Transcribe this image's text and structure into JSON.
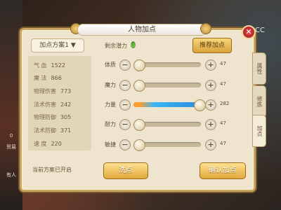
{
  "window": {
    "title": "人物加点",
    "title_decoration": "• • •   • • •",
    "close_label": "✕",
    "cc_label": "CC"
  },
  "left_strip": {
    "tag1": "0",
    "tag2": "贸易",
    "tag3": "有人"
  },
  "plan": {
    "selected": "加点方案1 ▼"
  },
  "stats": [
    {
      "label": "气  血",
      "value": "1522"
    },
    {
      "label": "魔  法",
      "value": "866"
    },
    {
      "label": "物理伤害",
      "value": "773"
    },
    {
      "label": "法术伤害",
      "value": "242"
    },
    {
      "label": "物理防御",
      "value": "305"
    },
    {
      "label": "法术防御",
      "value": "371"
    },
    {
      "label": "速  度",
      "value": "220"
    }
  ],
  "status_text": "当前方案已开启",
  "free_points": {
    "label": "剩余潜力",
    "value": "0"
  },
  "recommend_label": "推荐加点",
  "attributes": [
    {
      "name": "体质",
      "value": "47",
      "level": 0.03
    },
    {
      "name": "魔力",
      "value": "47",
      "level": 0.03
    },
    {
      "name": "力量",
      "value": "282",
      "level": 0.97
    },
    {
      "name": "耐力",
      "value": "47",
      "level": 0.03
    },
    {
      "name": "敏捷",
      "value": "47",
      "level": 0.03
    }
  ],
  "buttons": {
    "clear": "洗点",
    "confirm": "确认加点"
  },
  "side_tabs": [
    "属性",
    "修炼",
    "加点"
  ],
  "colors": {
    "accent": "#d9a23a",
    "panel": "#efe5cf",
    "close": "#c0282a",
    "blue_fill": "#2b8ee0"
  }
}
